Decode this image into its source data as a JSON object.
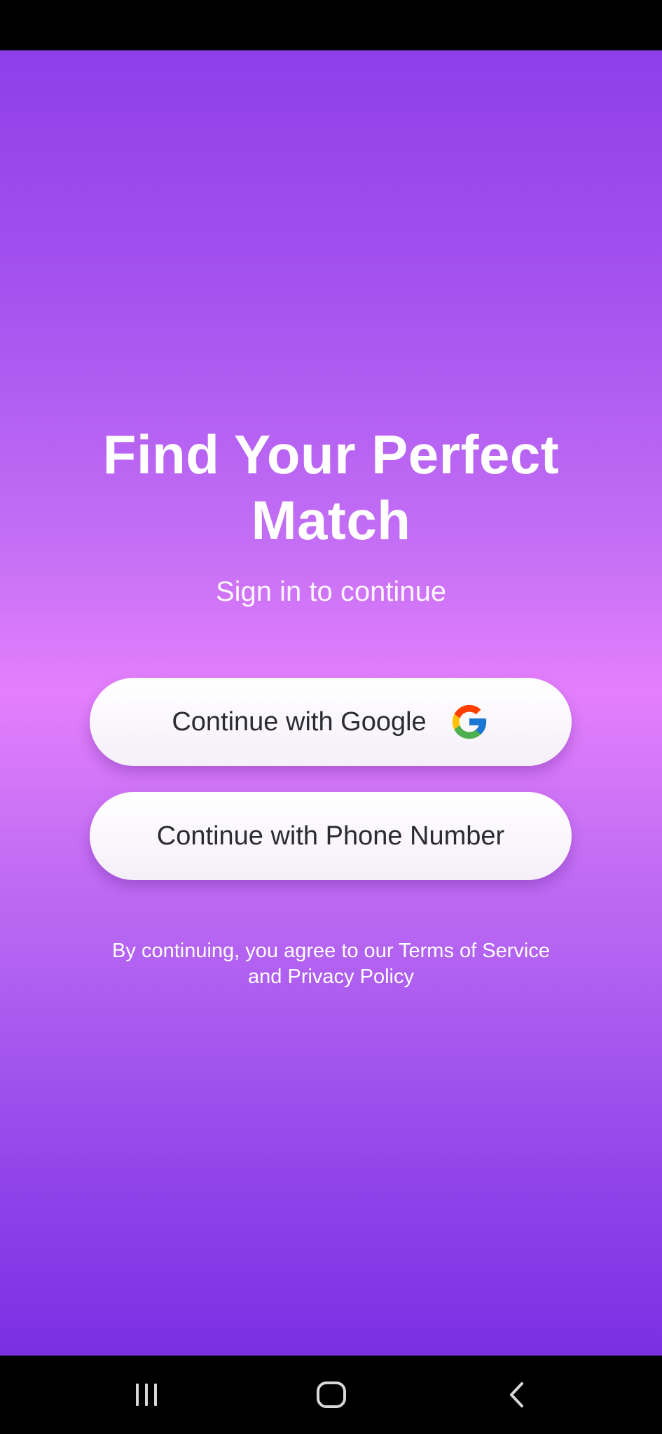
{
  "header": {
    "title": "Find Your Perfect Match",
    "subtitle": "Sign in to continue"
  },
  "auth": {
    "google_label": "Continue with Google",
    "phone_label": "Continue with Phone Number"
  },
  "legal": {
    "line1": "By continuing, you agree to our Terms of Service",
    "line2": "and Privacy Policy"
  },
  "icons": {
    "google": "google-logo-icon",
    "recent_apps": "recent-apps-icon",
    "home": "home-icon",
    "back": "back-icon"
  },
  "colors": {
    "gradient_top": "#8e3fe8",
    "gradient_mid": "#e47ffc",
    "gradient_bottom": "#7a2fe2",
    "button_bg": "#ffffff",
    "button_text": "#2b2b33",
    "text": "#ffffff"
  }
}
